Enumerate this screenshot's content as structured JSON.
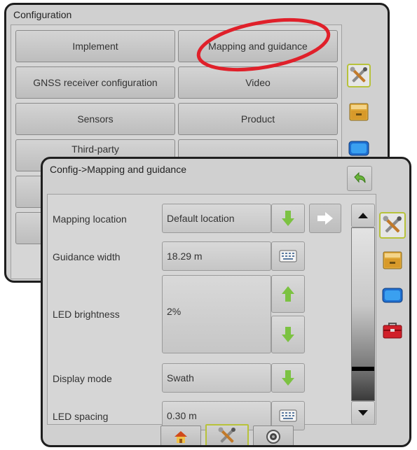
{
  "back_panel": {
    "title": "Configuration",
    "buttons": {
      "implement": "Implement",
      "mapping": "Mapping and guidance",
      "gnss": "GNSS receiver configuration",
      "video": "Video",
      "sensors": "Sensors",
      "product": "Product",
      "third_party": "Third-party"
    }
  },
  "front_panel": {
    "title": "Config->Mapping and guidance",
    "rows": {
      "mapping_location": {
        "label": "Mapping location",
        "value": "Default location"
      },
      "guidance_width": {
        "label": "Guidance width",
        "value": "18.29 m"
      },
      "led_brightness": {
        "label": "LED brightness",
        "value": "2%"
      },
      "display_mode": {
        "label": "Display mode",
        "value": "Swath"
      },
      "led_spacing": {
        "label": "LED spacing",
        "value": "0.30 m"
      }
    }
  },
  "annotation": {
    "color": "#e0202a",
    "target": "Mapping and guidance"
  },
  "icons": {
    "settings": "tools-icon",
    "data": "drawer-icon",
    "display": "monitor-icon",
    "system": "toolbox-icon",
    "home": "home-icon",
    "camera": "camera-icon",
    "back": "back-arrow-icon"
  },
  "colors": {
    "accent_border": "#b7c23a",
    "arrow_green": "#7cc242",
    "circle_red": "#e0202a"
  }
}
